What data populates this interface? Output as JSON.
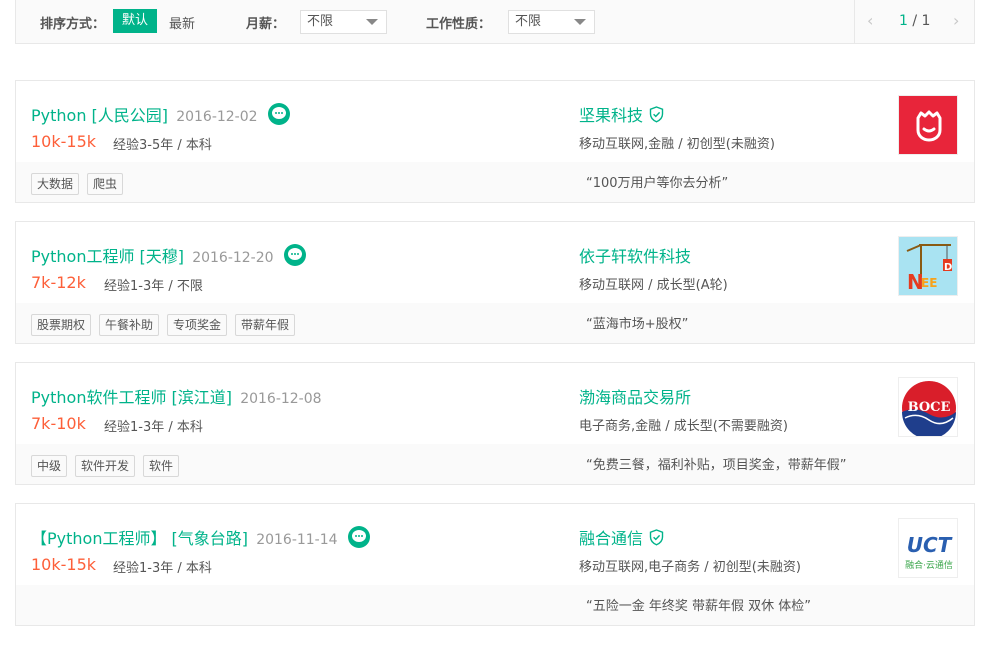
{
  "filters": {
    "sort_label": "排序方式：",
    "sort_default": "默认",
    "sort_latest": "最新",
    "salary_label": "月薪：",
    "salary_value": "不限",
    "jobtype_label": "工作性质：",
    "jobtype_value": "不限",
    "pager_current": "1",
    "pager_sep": " / ",
    "pager_total": "1",
    "pager_prev": "‹",
    "pager_next": "›"
  },
  "jobs": [
    {
      "position": "Python [人民公园]",
      "date": "2016-12-02",
      "salary": "10k-15k",
      "experience": "经验3-5年 / 本科",
      "tags": [
        "大数据",
        "爬虫"
      ],
      "company": "坚果科技",
      "verified": true,
      "industry": "移动互联网,金融 / 初创型(未融资)",
      "advantage": "“100万用户等你去分析”",
      "logo_icon": "nut-logo-icon"
    },
    {
      "position": "Python工程师 [天穆]",
      "date": "2016-12-20",
      "salary": "7k-12k",
      "experience": "经验1-3年 / 不限",
      "tags": [
        "股票期权",
        "午餐补助",
        "专项奖金",
        "带薪年假"
      ],
      "company": "依子轩软件科技",
      "verified": false,
      "industry": "移动互联网 / 成长型(A轮)",
      "advantage": "“蓝海市场+股权”",
      "logo_icon": "need-crane-logo-icon",
      "logo_text": "NEED"
    },
    {
      "position": "Python软件工程师 [滨江道]",
      "date": "2016-12-08",
      "salary": "7k-10k",
      "experience": "经验1-3年 / 本科",
      "tags": [
        "中级",
        "软件开发",
        "软件"
      ],
      "company": "渤海商品交易所",
      "verified": false,
      "industry": "电子商务,金融 / 成长型(不需要融资)",
      "advantage": "“免费三餐，福利补贴，项目奖金，带薪年假”",
      "logo_icon": "boce-logo-icon",
      "logo_text": "BOCE"
    },
    {
      "position": "【Python工程师】 [气象台路]",
      "date": "2016-11-14",
      "salary": "10k-15k",
      "experience": "经验1-3年 / 本科",
      "tags": [],
      "company": "融合通信",
      "verified": true,
      "industry": "移动互联网,电子商务 / 初创型(未融资)",
      "advantage": "“五险一金 年终奖 带薪年假 双休 体检”",
      "logo_icon": "uct-logo-icon",
      "logo_text": "UCT",
      "logo_subtext": "融合·云通信"
    }
  ],
  "colors": {
    "accent": "#00b38a",
    "salary": "#fd5f39",
    "nut_logo_bg": "#e8253a",
    "boce_red": "#d91e2a",
    "boce_blue": "#1f3e8c",
    "uct_blue": "#2a5fb0",
    "uct_green": "#3aa64b"
  }
}
